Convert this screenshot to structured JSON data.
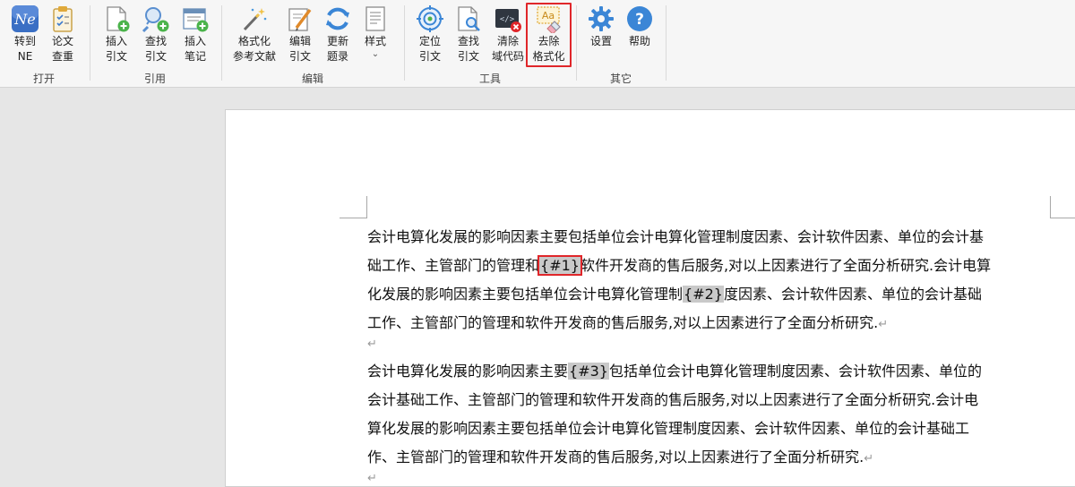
{
  "ribbon": {
    "groups": [
      {
        "label": "打开",
        "buttons": [
          {
            "line1": "转到",
            "line2": "NE",
            "icon": "ne-logo-icon"
          },
          {
            "line1": "论文",
            "line2": "查重",
            "icon": "clipboard-check-icon"
          }
        ]
      },
      {
        "label": "引用",
        "buttons": [
          {
            "line1": "插入",
            "line2": "引文",
            "icon": "insert-citation-icon"
          },
          {
            "line1": "查找",
            "line2": "引文",
            "icon": "search-citation-icon"
          },
          {
            "line1": "插入",
            "line2": "笔记",
            "icon": "insert-note-icon"
          }
        ]
      },
      {
        "label": "编辑",
        "buttons": [
          {
            "line1": "格式化",
            "line2": "参考文献",
            "icon": "magic-wand-icon"
          },
          {
            "line1": "编辑",
            "line2": "引文",
            "icon": "edit-citation-icon"
          },
          {
            "line1": "更新",
            "line2": "题录",
            "icon": "refresh-icon"
          },
          {
            "line1": "样式",
            "line2": "⌄",
            "icon": "style-document-icon"
          }
        ]
      },
      {
        "label": "工具",
        "buttons": [
          {
            "line1": "定位",
            "line2": "引文",
            "icon": "target-icon"
          },
          {
            "line1": "查找",
            "line2": "引文",
            "icon": "find-document-icon"
          },
          {
            "line1": "清除",
            "line2": "域代码",
            "icon": "clear-field-code-icon"
          },
          {
            "line1": "去除",
            "line2": "格式化",
            "icon": "remove-formatting-icon"
          }
        ]
      },
      {
        "label": "其它",
        "buttons": [
          {
            "line1": "设置",
            "line2": "",
            "icon": "gear-icon"
          },
          {
            "line1": "帮助",
            "line2": "",
            "icon": "help-icon"
          }
        ]
      }
    ]
  },
  "document": {
    "para1": {
      "l1": "会计电算化发展的影响因素主要包括单位会计电算化管理制度因素、会计软件因素、单位的会计基",
      "l2a": "础工作、主管部门的管理和",
      "cite1": "{#1}",
      "l2b": "软件开发商的售后服务,对以上因素进行了全面分析研究.会计电算",
      "l3a": "化发展的影响因素主要包括单位会计电算化管理制",
      "cite2": "{#2}",
      "l3b": "度因素、会计软件因素、单位的会计基础",
      "l4": "工作、主管部门的管理和软件开发商的售后服务,对以上因素进行了全面分析研究."
    },
    "para2": {
      "l1a": "会计电算化发展的影响因素主要",
      "cite3": "{#3}",
      "l1b": "包括单位会计电算化管理制度因素、会计软件因素、单位的",
      "l2": "会计基础工作、主管部门的管理和软件开发商的售后服务,对以上因素进行了全面分析研究.会计电",
      "l3": "算化发展的影响因素主要包括单位会计电算化管理制度因素、会计软件因素、单位的会计基础工",
      "l4": "作、主管部门的管理和软件开发商的售后服务,对以上因素进行了全面分析研究."
    },
    "paragraph_mark": "↵"
  },
  "colors": {
    "highlight_border": "#e0262a",
    "field_shading": "#c9c9c9"
  }
}
